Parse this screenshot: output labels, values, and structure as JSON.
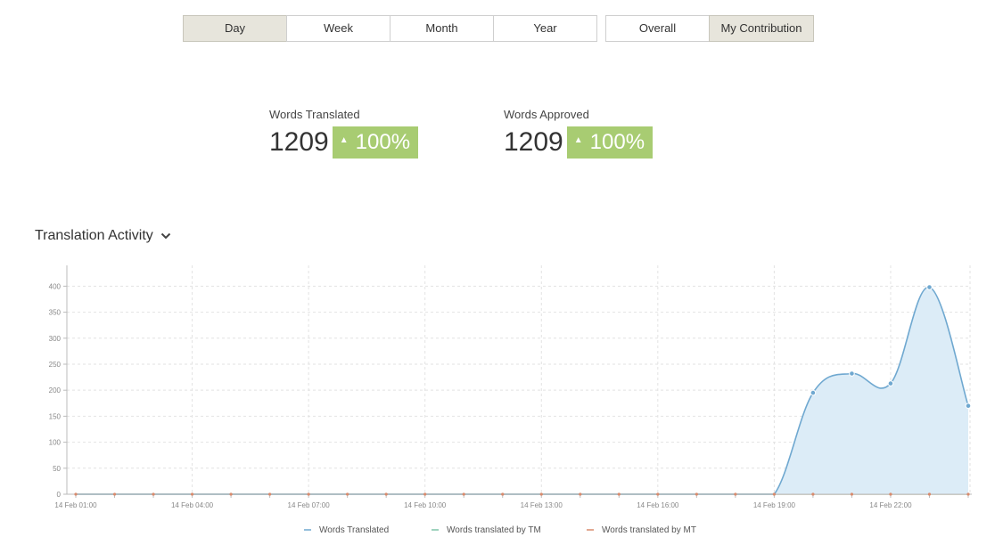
{
  "toolbar": {
    "period_buttons": [
      {
        "label": "Day",
        "active": true
      },
      {
        "label": "Week",
        "active": false
      },
      {
        "label": "Month",
        "active": false
      },
      {
        "label": "Year",
        "active": false
      }
    ],
    "scope_buttons": [
      {
        "label": "Overall",
        "active": false
      },
      {
        "label": "My Contribution",
        "active": true
      }
    ]
  },
  "stats": {
    "translated": {
      "label": "Words Translated",
      "value": "1209",
      "change": "100%"
    },
    "approved": {
      "label": "Words Approved",
      "value": "1209",
      "change": "100%"
    }
  },
  "section": {
    "title": "Translation Activity"
  },
  "colors": {
    "accent_green": "#a8cc72",
    "series_translated": "#6fa8d0",
    "series_tm": "#7fc4a8",
    "series_mt": "#d98a6c",
    "area_fill": "#dcecf7"
  },
  "chart_data": {
    "type": "area",
    "x": [
      "14 Feb 01:00",
      "14 Feb 02:00",
      "14 Feb 03:00",
      "14 Feb 04:00",
      "14 Feb 05:00",
      "14 Feb 06:00",
      "14 Feb 07:00",
      "14 Feb 08:00",
      "14 Feb 09:00",
      "14 Feb 10:00",
      "14 Feb 11:00",
      "14 Feb 12:00",
      "14 Feb 13:00",
      "14 Feb 14:00",
      "14 Feb 15:00",
      "14 Feb 16:00",
      "14 Feb 17:00",
      "14 Feb 18:00",
      "14 Feb 19:00",
      "14 Feb 20:00",
      "14 Feb 21:00",
      "14 Feb 22:00",
      "14 Feb 23:00",
      "15 Feb 00:00"
    ],
    "x_tick_labels": [
      "14 Feb 01:00",
      "14 Feb 04:00",
      "14 Feb 07:00",
      "14 Feb 10:00",
      "14 Feb 13:00",
      "14 Feb 16:00",
      "14 Feb 19:00",
      "14 Feb 22:00"
    ],
    "ylim": [
      0,
      440
    ],
    "yticks": [
      0,
      50,
      100,
      150,
      200,
      250,
      300,
      350,
      400
    ],
    "grid": true,
    "legend_position": "bottom",
    "series": [
      {
        "name": "Words Translated",
        "values": [
          0,
          0,
          0,
          0,
          0,
          0,
          0,
          0,
          0,
          0,
          0,
          0,
          0,
          0,
          0,
          0,
          0,
          0,
          0,
          195,
          232,
          213,
          398,
          170
        ]
      },
      {
        "name": "Words translated by TM",
        "values": [
          0,
          0,
          0,
          0,
          0,
          0,
          0,
          0,
          0,
          0,
          0,
          0,
          0,
          0,
          0,
          0,
          0,
          0,
          0,
          0,
          0,
          0,
          0,
          0
        ]
      },
      {
        "name": "Words translated by MT",
        "values": [
          0,
          0,
          0,
          0,
          0,
          0,
          0,
          0,
          0,
          0,
          0,
          0,
          0,
          0,
          0,
          0,
          0,
          0,
          0,
          0,
          0,
          0,
          0,
          0
        ]
      }
    ]
  }
}
